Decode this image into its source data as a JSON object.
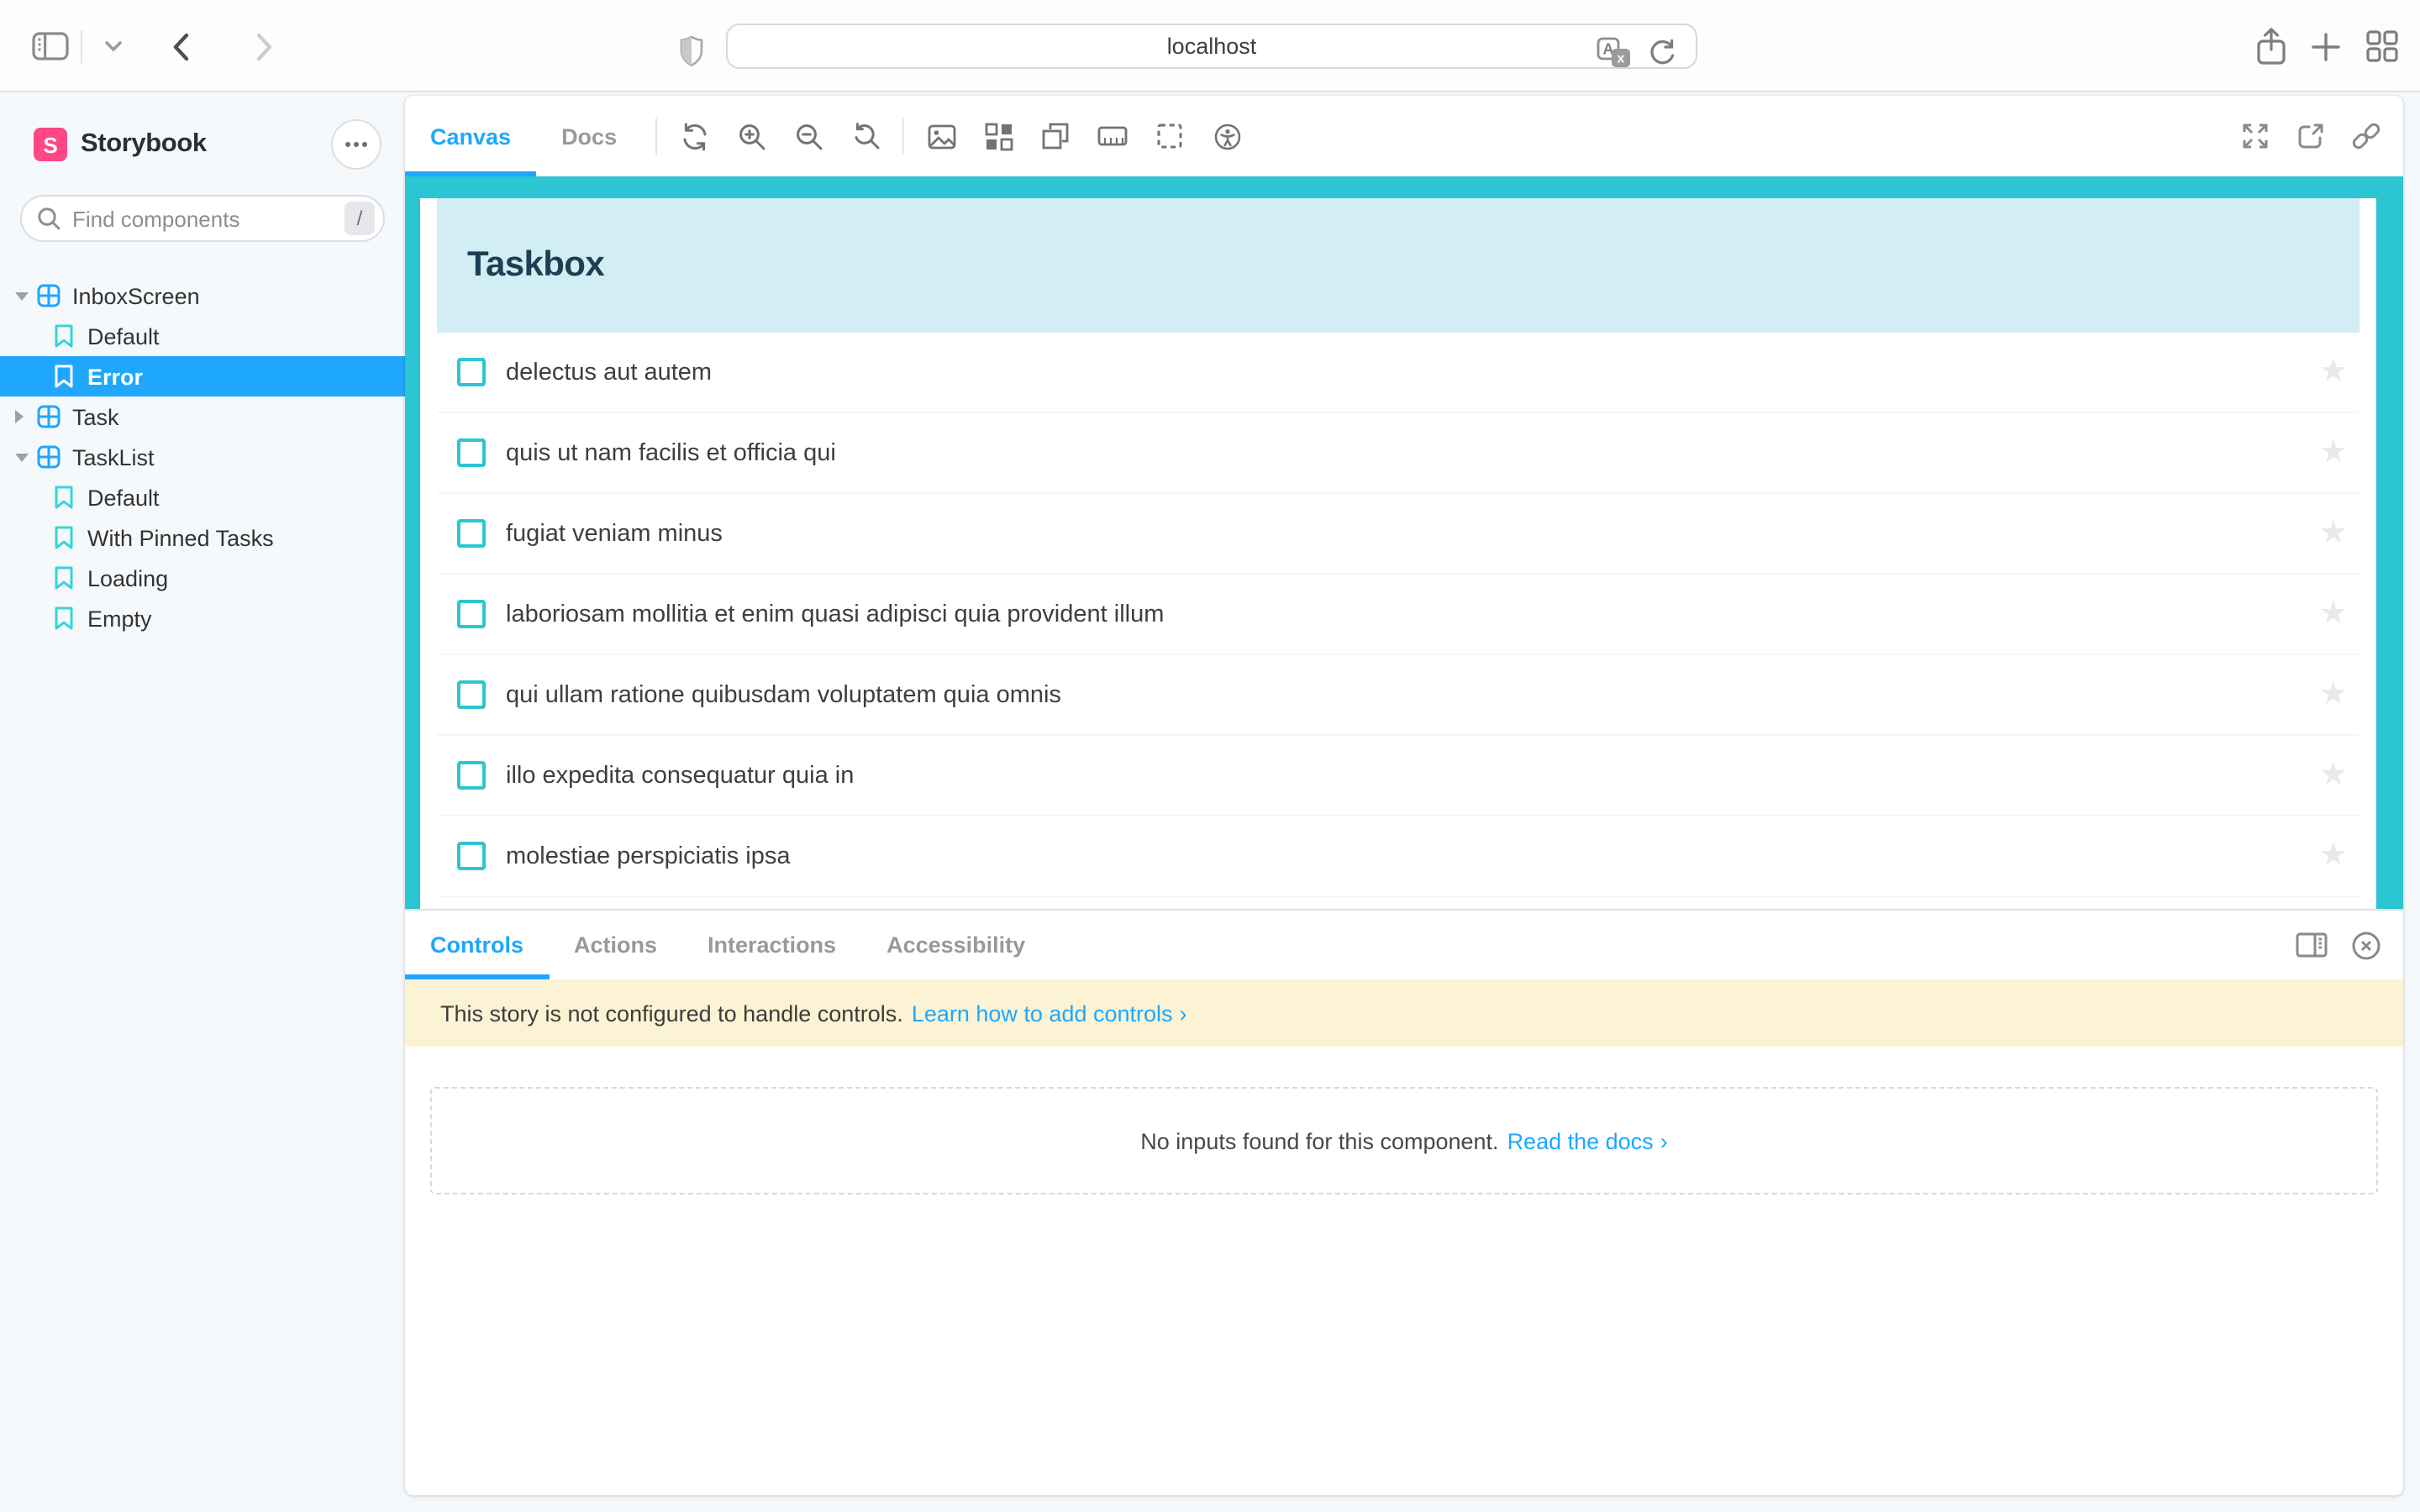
{
  "browser": {
    "url": "localhost",
    "left_icons": [
      "sidebar-toggle-icon",
      "tabs-chevron-icon"
    ],
    "nav_back_icon": "back-icon",
    "nav_forward_icon": "forward-icon",
    "shield_icon": "privacy-shield-icon",
    "url_icons": [
      "translate-icon",
      "reload-icon"
    ],
    "right_icons": [
      "share-icon",
      "new-tab-icon",
      "tab-overview-icon"
    ]
  },
  "sidebar": {
    "brand": "Storybook",
    "logo_letter": "S",
    "menu_icon": "ellipsis-icon",
    "search": {
      "placeholder": "Find components",
      "shortcut": "/"
    },
    "tree": [
      {
        "kind": "component",
        "label": "InboxScreen",
        "expanded": true
      },
      {
        "kind": "story",
        "label": "Default",
        "selected": false
      },
      {
        "kind": "story",
        "label": "Error",
        "selected": true
      },
      {
        "kind": "component",
        "label": "Task",
        "expanded": false
      },
      {
        "kind": "component",
        "label": "TaskList",
        "expanded": true
      },
      {
        "kind": "story",
        "label": "Default",
        "selected": false
      },
      {
        "kind": "story",
        "label": "With Pinned Tasks",
        "selected": false
      },
      {
        "kind": "story",
        "label": "Loading",
        "selected": false
      },
      {
        "kind": "story",
        "label": "Empty",
        "selected": false
      }
    ]
  },
  "canvas": {
    "tabs": [
      {
        "label": "Canvas",
        "active": true
      },
      {
        "label": "Docs",
        "active": false
      }
    ],
    "zoom_group_icons": [
      "remount-icon",
      "zoom-in-icon",
      "zoom-out-icon",
      "zoom-reset-icon"
    ],
    "addon_group_icons": [
      "background-icon",
      "grid-icon",
      "viewport-icon",
      "measure-icon",
      "outline-icon",
      "accessibility-icon"
    ],
    "right_icons": [
      "fullscreen-icon",
      "open-new-tab-icon",
      "copy-link-icon"
    ],
    "preview": {
      "title": "Taskbox",
      "star_icon": "★",
      "tasks": [
        "delectus aut autem",
        "quis ut nam facilis et officia qui",
        "fugiat veniam minus",
        "laboriosam mollitia et enim quasi adipisci quia provident illum",
        "qui ullam ratione quibusdam voluptatem quia omnis",
        "illo expedita consequatur quia in",
        "molestiae perspiciatis ipsa"
      ]
    }
  },
  "panel": {
    "tabs": [
      {
        "label": "Controls",
        "active": true
      },
      {
        "label": "Actions",
        "active": false
      },
      {
        "label": "Interactions",
        "active": false
      },
      {
        "label": "Accessibility",
        "active": false
      }
    ],
    "right_icons": [
      "panel-position-icon",
      "close-panel-icon"
    ],
    "banner": {
      "text": "This story is not configured to handle controls.",
      "link_label": "Learn how to add controls",
      "chevron": "›"
    },
    "empty": {
      "text": "No inputs found for this component.",
      "link_label": "Read the docs",
      "chevron": "›"
    }
  },
  "colors": {
    "accent": "#1EA7FD",
    "brand": "#FF4785",
    "story": "#37D5D3",
    "cyan": "#2CC5D2",
    "lightblue": "#D3EDF4",
    "heading": "#1C3F53",
    "banner": "#FBF3D3",
    "sidebar_bg": "#F6F9FC"
  }
}
